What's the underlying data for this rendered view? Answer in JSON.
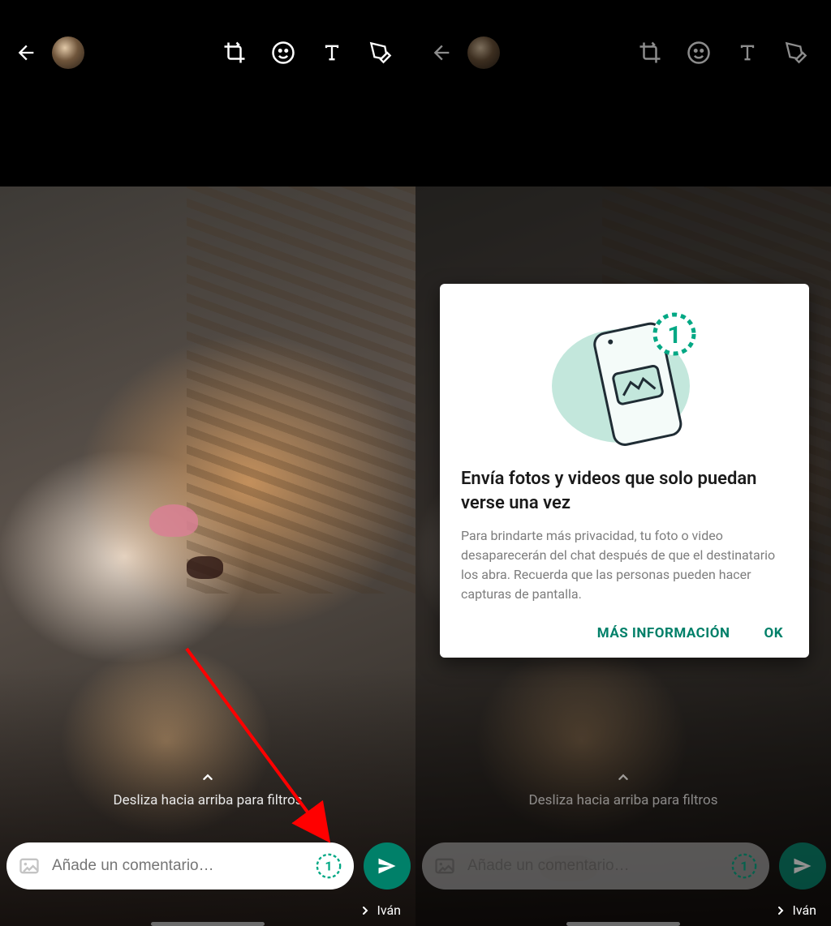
{
  "colors": {
    "accent": "#008069"
  },
  "left": {
    "filters_hint": "Desliza hacia arriba para filtros",
    "caption_placeholder": "Añade un comentario…",
    "recipient": "Iván"
  },
  "right": {
    "filters_hint": "Desliza hacia arriba para filtros",
    "caption_placeholder": "Añade un comentario…",
    "recipient": "Iván"
  },
  "modal": {
    "title": "Envía fotos y videos que solo puedan verse una vez",
    "body": "Para brindarte más privacidad, tu foto o video desaparecerán del chat después de que el destinatario los abra. Recuerda que las personas pueden hacer capturas de pantalla.",
    "more_info": "MÁS INFORMACIÓN",
    "ok": "OK",
    "badge_digit": "1"
  }
}
